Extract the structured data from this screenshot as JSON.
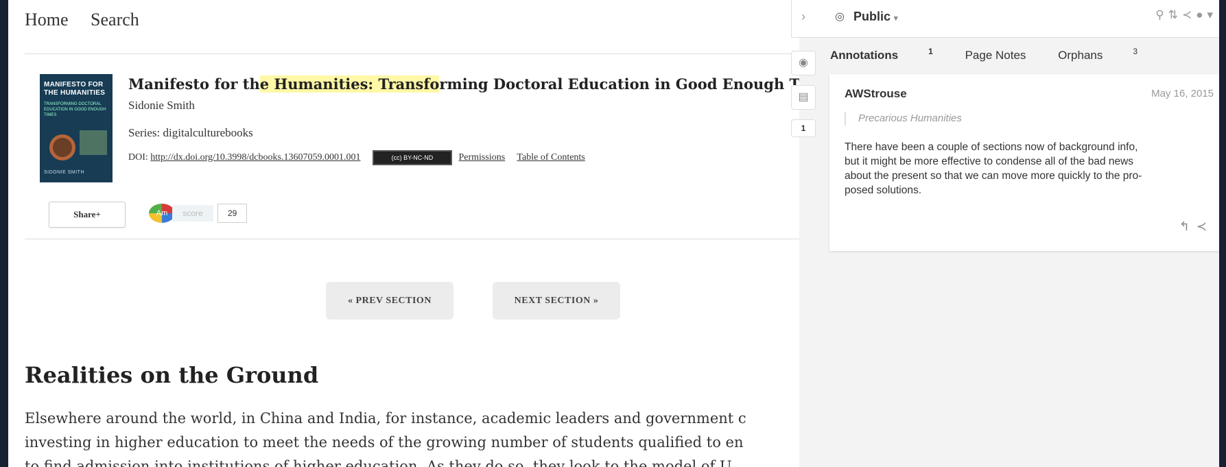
{
  "nav": {
    "home": "Home",
    "search": "Search"
  },
  "cover": {
    "title_line1": "MANIFESTO FOR",
    "title_line2": "THE HUMANITIES",
    "subtitle": "TRANSFORMING DOCTORAL EDUCATION IN GOOD ENOUGH TIMES",
    "author": "SIDONIE SMITH"
  },
  "book": {
    "title_pre": "Manifesto for th",
    "title_hl": "e Humanities: Transfo",
    "title_post": "rming Doctoral Education in Good Enough Times",
    "author": "Sidonie Smith",
    "series": "Series: digitalculturebooks",
    "doi_label": "DOI:",
    "doi_link": "http://dx.doi.org/10.3998/dcbooks.13607059.0001.001",
    "license": "(cc) BY-NC-ND",
    "permissions": "Permissions",
    "toc": "Table of Contents"
  },
  "share": {
    "label": "Share+"
  },
  "altmetric": {
    "badge": "Am",
    "score_label": "score",
    "value": "29"
  },
  "section_nav": {
    "prev": "« PREV SECTION",
    "next": "NEXT SECTION »"
  },
  "content": {
    "heading": "Realities on the Ground",
    "lines": [
      "Elsewhere around the world, in China and India, for instance, academic leaders and government c",
      "investing in higher education to meet the needs of the growing number of students qualified to en",
      "to find admission into institutions of higher education. As they do so, they look to the model of U"
    ]
  },
  "sidebar": {
    "collapse_icon": "chevron-right-icon",
    "scope": "Public",
    "tabs": {
      "annotations": "Annotations",
      "annotations_count": "1",
      "page_notes": "Page Notes",
      "orphans": "Orphans",
      "orphans_count": "3"
    },
    "count_badge": "1",
    "annotation": {
      "user": "AWStrouse",
      "date": "May 16, 2015",
      "quote": "Precarious Humanities",
      "lines": [
        "There have been a couple of sections now of background info,",
        "but it might be more effective to condense all of the bad news",
        "about the present so that we can move more quickly to the pro-",
        "posed solutions."
      ]
    }
  },
  "colors": {
    "highlight": "#fff8a6",
    "frame": "#162131",
    "panel": "#f3f3f3"
  }
}
